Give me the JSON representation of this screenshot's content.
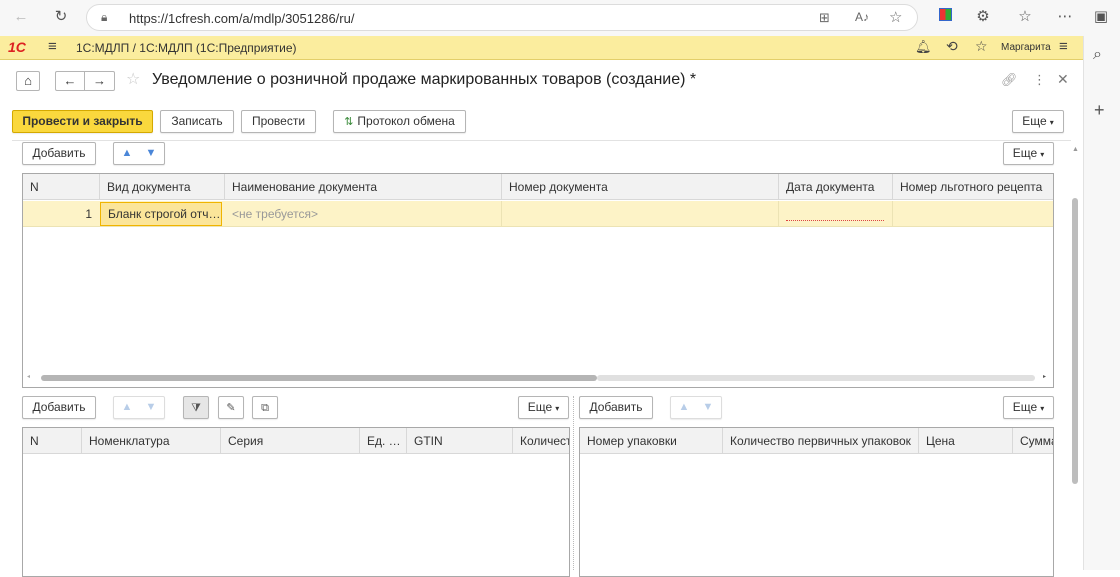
{
  "browser": {
    "url": "https://1cfresh.com/a/mdlp/3051286/ru/"
  },
  "app": {
    "logo": "1С",
    "title": "1С:МДЛП / 1С:МДЛП  (1С:Предприятие)",
    "user": "Маргарита"
  },
  "form": {
    "title": "Уведомление о розничной продаже маркированных товаров (создание) *",
    "toolbar": {
      "post_close": "Провести и закрыть",
      "save": "Записать",
      "post": "Провести",
      "exchange_log": "Протокол обмена",
      "more": "Еще"
    },
    "docs_table": {
      "add": "Добавить",
      "more": "Еще",
      "columns": [
        "N",
        "Вид документа",
        "Наименование документа",
        "Номер документа",
        "Дата документа",
        "Номер льготного рецепта"
      ],
      "rows": [
        {
          "n": "1",
          "doc_type": "Бланк строгой отч…",
          "doc_name": "<не требуется>",
          "doc_number": "",
          "doc_date": "",
          "recipe": ""
        }
      ]
    },
    "goods_table": {
      "add": "Добавить",
      "more": "Еще",
      "columns": [
        "N",
        "Номенклатура",
        "Серия",
        "Ед. …",
        "GTIN",
        "Количест"
      ]
    },
    "packs_table": {
      "add": "Добавить",
      "more": "Еще",
      "columns": [
        "Номер упаковки",
        "Количество первичных упаковок",
        "Цена",
        "Сумма"
      ]
    }
  },
  "colors": {
    "header_yellow": "#fbed9e",
    "primary_button": "#fad83d",
    "selected_row": "#fdf3c7",
    "active_cell_border": "#f0b400"
  }
}
